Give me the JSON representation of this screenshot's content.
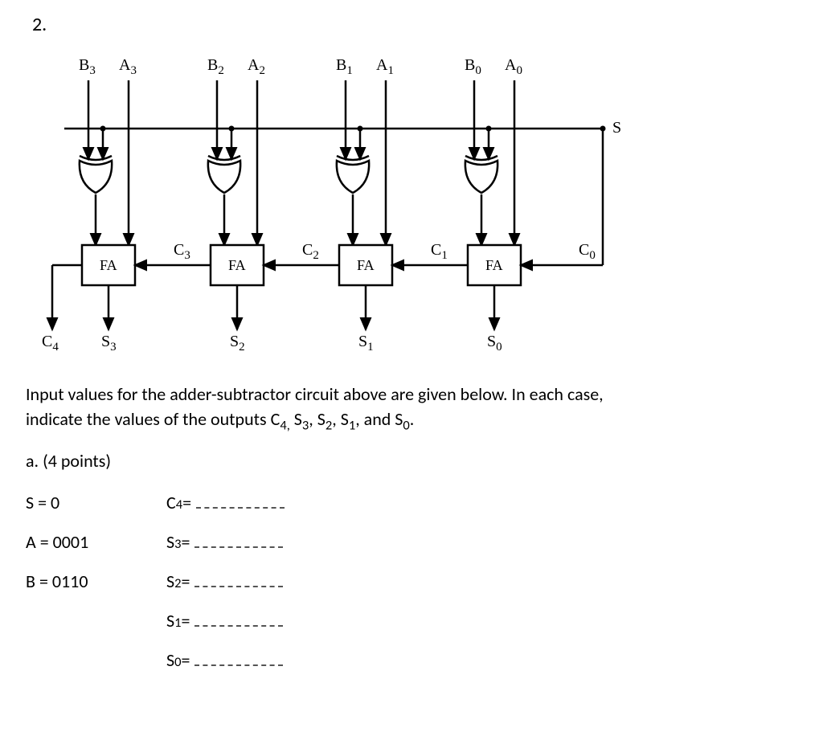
{
  "question_number": "2.",
  "instruction_line1": "Input values for the adder-subtractor circuit above are given below.  In each case,",
  "instruction_line2_pre": "indicate the values of the outputs C",
  "inst_c_sub": "4,",
  "inst_mid1": " S",
  "inst_s3": "3",
  "comma1": ", S",
  "inst_s2": "2",
  "comma2": ", S",
  "inst_s1": "1",
  "comma3": ", and S",
  "inst_s0": "0",
  "inst_end": ".",
  "part_a": "a.  (4 points)",
  "inputs": {
    "s": "S = 0",
    "a": "A = 0001",
    "b": "B = 0110"
  },
  "outputs": {
    "c4": {
      "var": "C",
      "sub": "4",
      "eq": " = "
    },
    "s3": {
      "var": "S",
      "sub": "3",
      "eq": " = "
    },
    "s2": {
      "var": "S",
      "sub": "2",
      "eq": " = "
    },
    "s1": {
      "var": "S",
      "sub": "1",
      "eq": " = "
    },
    "s0": {
      "var": "S",
      "sub": "0",
      "eq": " = "
    }
  },
  "diagram": {
    "top_labels": {
      "B3": "B",
      "B3s": "3",
      "A3": "A",
      "A3s": "3",
      "B2": "B",
      "B2s": "2",
      "A2": "A",
      "A2s": "2",
      "B1": "B",
      "B1s": "1",
      "A1": "A",
      "A1s": "1",
      "B0": "B",
      "B0s": "0",
      "A0": "A",
      "A0s": "0",
      "S": "S"
    },
    "fa_label": "FA",
    "carry": {
      "C0": "C",
      "C0s": "0",
      "C1": "C",
      "C1s": "1",
      "C2": "C",
      "C2s": "2",
      "C3": "C",
      "C3s": "3",
      "C4": "C",
      "C4s": "4"
    },
    "bottom": {
      "S0": "S",
      "S0s": "0",
      "S1": "S",
      "S1s": "1",
      "S2": "S",
      "S2s": "2",
      "S3": "S",
      "S3s": "3"
    }
  }
}
